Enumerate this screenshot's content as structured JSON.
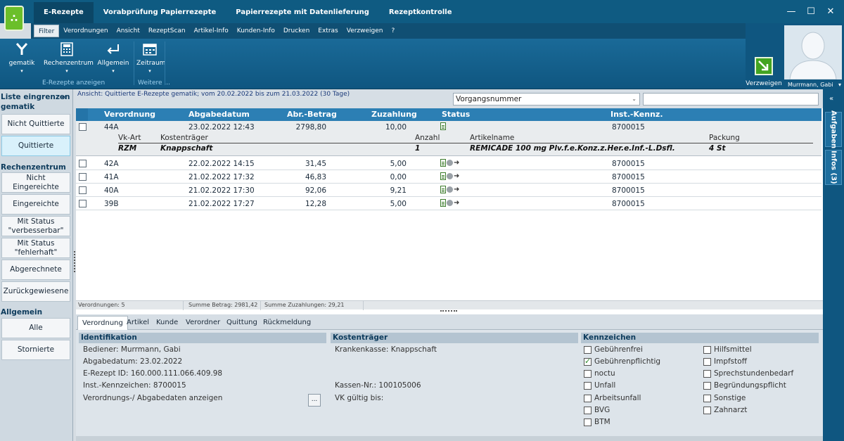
{
  "app": {
    "logo_glyph": "∴",
    "main_tabs": [
      "E-Rezepte",
      "Vorabprüfung Papierrezepte",
      "Papierrezepte mit Datenlieferung",
      "Rezeptkontrolle"
    ],
    "window_controls": [
      "—",
      "☐",
      "✕"
    ]
  },
  "menu": {
    "items": [
      "Filter",
      "Verordnungen",
      "Ansicht",
      "RezeptScan",
      "Artikel-Info",
      "Kunden-Info",
      "Drucken",
      "Extras",
      "Verzweigen",
      "?"
    ]
  },
  "ribbon": {
    "gematik": "gematik",
    "rechenzentrum": "Rechenzentrum",
    "allgemein": "Allgemein",
    "zeitraum": "Zeitraum",
    "group1_label": "E-Rezepte anzeigen",
    "group2_label": "Weitere ...",
    "caret": "▾"
  },
  "verzweigen": {
    "label": "Verzweigen"
  },
  "user": {
    "name": "Murrmann, Gabi",
    "caret": "▾"
  },
  "left": {
    "title_line1": "Liste eingrenzen",
    "title_line2": "gematik",
    "pin": "«",
    "btn_nicht_quittiert": "Nicht Quittierte",
    "btn_quittiert": "Quittierte",
    "rz_head": "Rechenzentrum",
    "btn_nicht_eingereicht": "Nicht Eingereichte",
    "btn_eingereicht": "Eingereichte",
    "btn_verbesserbar_1": "Mit Status",
    "btn_verbesserbar_2": "\"verbesserbar\"",
    "btn_fehlerhaft_1": "Mit Status",
    "btn_fehlerhaft_2": "\"fehlerhaft\"",
    "btn_abgerechnet": "Abgerechnete",
    "btn_zurueck": "Zurückgewiesene",
    "allg_head": "Allgemein",
    "btn_alle": "Alle",
    "btn_storniert": "Stornierte"
  },
  "view": {
    "text": "Ansicht: Quittierte E-Rezepte gematik; vom 20.02.2022 bis zum 21.03.2022 (30 Tage)",
    "select_value": "Vorgangsnummer",
    "select_arrow": "⌄"
  },
  "grid": {
    "columns": {
      "verordnung": "Verordnung",
      "abgabedatum": "Abgabedatum",
      "betrag": "Abr.-Betrag",
      "zuzahlung": "Zuzahlung",
      "status": "Status",
      "ik": "Inst.-Kennz."
    },
    "rows": [
      {
        "verordnung": "44A",
        "datum": "23.02.2022 12:43",
        "betrag": "2798,80",
        "zuzahlung": "10,00",
        "ik": "8700015"
      },
      {
        "verordnung": "42A",
        "datum": "22.02.2022 14:15",
        "betrag": "31,45",
        "zuzahlung": "5,00",
        "ik": "8700015"
      },
      {
        "verordnung": "41A",
        "datum": "21.02.2022 17:32",
        "betrag": "46,83",
        "zuzahlung": "0,00",
        "ik": "8700015"
      },
      {
        "verordnung": "40A",
        "datum": "21.02.2022 17:30",
        "betrag": "92,06",
        "zuzahlung": "9,21",
        "ik": "8700015"
      },
      {
        "verordnung": "39B",
        "datum": "21.02.2022 17:27",
        "betrag": "12,28",
        "zuzahlung": "5,00",
        "ik": "8700015"
      }
    ],
    "sub_headers": {
      "vkart": "Vk-Art",
      "kostentraeger": "Kostenträger",
      "anzahl": "Anzahl",
      "artikelname": "Artikelname",
      "packung": "Packung"
    },
    "sub_values": {
      "vkart": "RZM",
      "kostentraeger": "Knappschaft",
      "anzahl": "1",
      "artikelname": "REMICADE 100 mg Plv.f.e.Konz.z.Her.e.Inf.-L.Dsfl.",
      "packung": "4 St"
    },
    "arrow_glyph": "➜"
  },
  "summary": {
    "verordnungen": "Verordnungen: 5",
    "summe_betrag": "Summe Betrag: 2981,42",
    "summe_zuzahlungen": "Summe Zuzahlungen: 29,21"
  },
  "detail_tabs": [
    "Verordnung",
    "Artikel",
    "Kunde",
    "Verordner",
    "Quittung",
    "Rückmeldung"
  ],
  "detail": {
    "ident_head": "Identifikation",
    "bediener": "Bediener: Murrmann, Gabi",
    "abgabedatum": "Abgabedatum: 23.02.2022",
    "erezept_id": "E-Rezept ID: 160.000.111.066.409.98",
    "ik": "Inst.-Kennzeichen: 8700015",
    "daten_anzeigen": "Verordnungs-/ Abgabedaten anzeigen",
    "ellipsis": "...",
    "kt_head": "Kostenträger",
    "krankenkasse": "Krankenkasse:  Knappschaft",
    "kassen_nr": "Kassen-Nr.: 100105006",
    "vk_gueltig": "VK gültig bis:",
    "kz_head": "Kennzeichen",
    "kz_left": [
      {
        "label": "Gebührenfrei",
        "checked": false
      },
      {
        "label": "Gebührenpflichtig",
        "checked": true
      },
      {
        "label": "noctu",
        "checked": false
      },
      {
        "label": "Unfall",
        "checked": false
      },
      {
        "label": "Arbeitsunfall",
        "checked": false
      },
      {
        "label": "BVG",
        "checked": false
      },
      {
        "label": "BTM",
        "checked": false
      }
    ],
    "kz_right": [
      {
        "label": "Hilfsmittel",
        "checked": false
      },
      {
        "label": "Impfstoff",
        "checked": false
      },
      {
        "label": "Sprechstundenbedarf",
        "checked": false
      },
      {
        "label": "Begründungspflicht",
        "checked": false
      },
      {
        "label": "Sonstige",
        "checked": false
      },
      {
        "label": "Zahnarzt",
        "checked": false
      }
    ]
  },
  "rail": {
    "pin": "«",
    "aufgaben": "Aufgaben",
    "infos": "Infos (3)"
  }
}
